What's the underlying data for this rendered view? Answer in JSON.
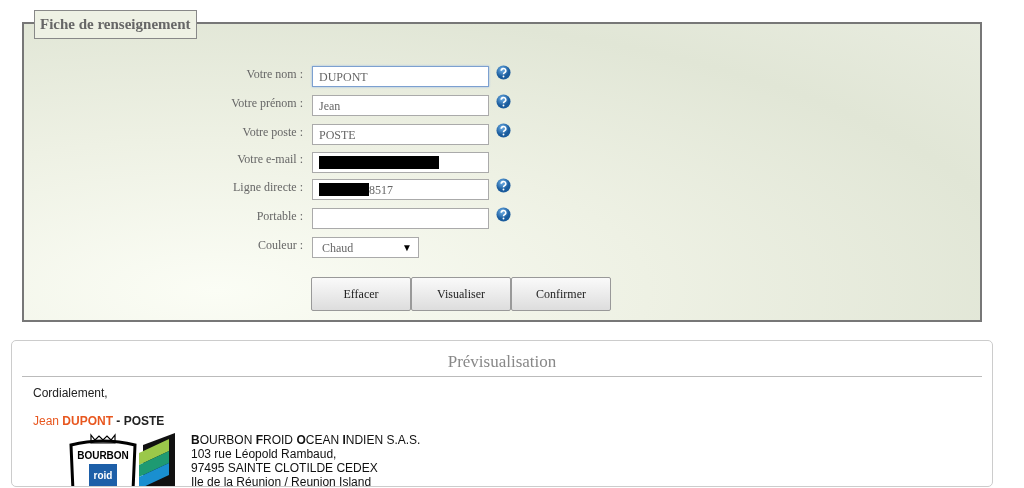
{
  "form": {
    "legend": "Fiche de renseignement",
    "fields": [
      {
        "kind": "text",
        "label": "Votre nom :",
        "value": "DUPONT",
        "focused": true,
        "help": true
      },
      {
        "kind": "text",
        "label": "Votre prénom :",
        "value": "Jean",
        "focused": false,
        "help": true
      },
      {
        "kind": "text",
        "label": "Votre poste :",
        "value": "POSTE",
        "focused": false,
        "help": true
      },
      {
        "kind": "redacted",
        "label": "Votre e-mail :",
        "focused": false,
        "help": false
      },
      {
        "kind": "redacted",
        "label": "Ligne directe :",
        "value": "8517",
        "focused": false,
        "help": true
      },
      {
        "kind": "text",
        "label": "Portable :",
        "focused": false,
        "help": true
      },
      {
        "kind": "select",
        "label": "Couleur :",
        "value": "Chaud",
        "arrow": "▼",
        "focused": false,
        "help": false
      }
    ],
    "buttons": [
      "Effacer",
      "Visualiser",
      "Confirmer"
    ]
  },
  "preview": {
    "title": "Prévisualisation",
    "greeting": "Cordialement,",
    "signature": {
      "first_name": "Jean",
      "last_name": "DUPONT",
      "post": "- POSTE"
    },
    "logo": {
      "text": "BOURBON",
      "text2": "roid"
    },
    "address": [
      "**B**OURBON **F**ROID **O**CEAN **I**NDIEN S.A.S.",
      "103 rue Léopold Rambaud,",
      "97495 SAINTE CLOTILDE CEDEX",
      "Ile de la Réunion / Reunion Island"
    ]
  }
}
